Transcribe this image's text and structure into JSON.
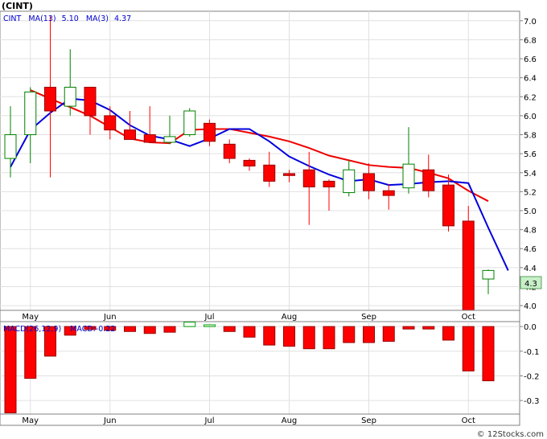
{
  "header": {
    "title": "(CINT)",
    "ticker": "CINT",
    "ma_long_label": "MA(13)",
    "ma_long_value": "5.10",
    "ma_short_label": "MA(3)",
    "ma_short_value": "4.37"
  },
  "macd_header": {
    "label": "MACD(26,12,9)",
    "value_label": "MACD:-0.22"
  },
  "last_price_tag": "4.3",
  "footer": "© 12Stocks.com",
  "colors": {
    "up": "#008000",
    "down": "#ff0000",
    "ma_long": "#ee0000",
    "ma_short": "#0000dd",
    "macd_neg": "#ff0000",
    "macd_pos": "#00a000",
    "header_text": "#0000cc",
    "price_tag_bg": "#c8f0c8"
  },
  "chart_data": [
    {
      "type": "candlestick",
      "series_name": "CINT",
      "x_tick_labels": [
        "May",
        "Jun",
        "Jul",
        "Aug",
        "Sep",
        "Oct"
      ],
      "x_tick_index": [
        1,
        5,
        10,
        14,
        18,
        23
      ],
      "ylim": [
        3.95,
        7.1
      ],
      "y_ticks": [
        4.0,
        4.2,
        4.4,
        4.6,
        4.8,
        5.0,
        5.2,
        5.4,
        5.6,
        5.8,
        6.0,
        6.2,
        6.4,
        6.6,
        6.8,
        7.0
      ],
      "candles": [
        {
          "o": 5.55,
          "h": 6.1,
          "l": 5.35,
          "c": 5.8
        },
        {
          "o": 5.8,
          "h": 6.3,
          "l": 5.5,
          "c": 6.25
        },
        {
          "o": 6.3,
          "h": 7.05,
          "l": 5.35,
          "c": 6.05
        },
        {
          "o": 6.1,
          "h": 6.7,
          "l": 6.0,
          "c": 6.3
        },
        {
          "o": 6.3,
          "h": 6.3,
          "l": 5.8,
          "c": 6.0
        },
        {
          "o": 6.0,
          "h": 6.1,
          "l": 5.75,
          "c": 5.85
        },
        {
          "o": 5.85,
          "h": 6.05,
          "l": 5.75,
          "c": 5.75
        },
        {
          "o": 5.8,
          "h": 6.1,
          "l": 5.72,
          "c": 5.72
        },
        {
          "o": 5.72,
          "h": 6.0,
          "l": 5.7,
          "c": 5.78
        },
        {
          "o": 5.8,
          "h": 6.08,
          "l": 5.78,
          "c": 6.05
        },
        {
          "o": 5.92,
          "h": 5.96,
          "l": 5.68,
          "c": 5.73
        },
        {
          "o": 5.7,
          "h": 5.75,
          "l": 5.5,
          "c": 5.55
        },
        {
          "o": 5.53,
          "h": 5.55,
          "l": 5.42,
          "c": 5.47
        },
        {
          "o": 5.48,
          "h": 5.62,
          "l": 5.25,
          "c": 5.31
        },
        {
          "o": 5.39,
          "h": 5.43,
          "l": 5.3,
          "c": 5.37
        },
        {
          "o": 5.43,
          "h": 5.62,
          "l": 4.85,
          "c": 5.25
        },
        {
          "o": 5.31,
          "h": 5.33,
          "l": 5.0,
          "c": 5.25
        },
        {
          "o": 5.19,
          "h": 5.53,
          "l": 5.15,
          "c": 5.43
        },
        {
          "o": 5.39,
          "h": 5.5,
          "l": 5.12,
          "c": 5.21
        },
        {
          "o": 5.21,
          "h": 5.28,
          "l": 5.01,
          "c": 5.16
        },
        {
          "o": 5.24,
          "h": 5.88,
          "l": 5.18,
          "c": 5.49
        },
        {
          "o": 5.43,
          "h": 5.59,
          "l": 5.14,
          "c": 5.21
        },
        {
          "o": 5.27,
          "h": 5.38,
          "l": 4.78,
          "c": 4.84
        },
        {
          "o": 4.89,
          "h": 5.05,
          "l": 3.95,
          "c": 3.95
        },
        {
          "o": 4.28,
          "h": 4.38,
          "l": 4.12,
          "c": 4.37
        }
      ],
      "ma13": [
        6.27,
        6.18,
        6.09,
        6.0,
        5.88,
        5.76,
        5.72,
        5.71,
        5.85,
        5.86,
        5.86,
        5.82,
        5.78,
        5.73,
        5.66,
        5.58,
        5.53,
        5.48,
        5.46,
        5.45,
        5.4,
        5.34,
        5.21,
        5.1
      ],
      "ma13_start_index": 1,
      "ma3": [
        5.46,
        5.85,
        6.03,
        6.18,
        6.16,
        6.06,
        5.9,
        5.79,
        5.75,
        5.68,
        5.76,
        5.86,
        5.86,
        5.73,
        5.57,
        5.47,
        5.38,
        5.31,
        5.33,
        5.27,
        5.28,
        5.3,
        5.31,
        5.29,
        4.82,
        4.37
      ],
      "ma3_start_index": 0
    },
    {
      "type": "bar",
      "series_name": "MACD(26,12,9)",
      "ylim": [
        -0.355,
        0.02
      ],
      "y_ticks": [
        0.0,
        -0.1,
        -0.2,
        -0.3
      ],
      "y_tick_labels": [
        "0.0",
        "-0.1",
        "-0.2",
        "-0.3"
      ],
      "values": [
        -0.35,
        -0.21,
        -0.12,
        -0.035,
        -0.012,
        -0.015,
        -0.02,
        -0.028,
        -0.023,
        0.018,
        0.007,
        -0.02,
        -0.043,
        -0.075,
        -0.08,
        -0.09,
        -0.09,
        -0.065,
        -0.065,
        -0.06,
        -0.01,
        -0.01,
        -0.055,
        -0.18,
        -0.22
      ]
    }
  ]
}
